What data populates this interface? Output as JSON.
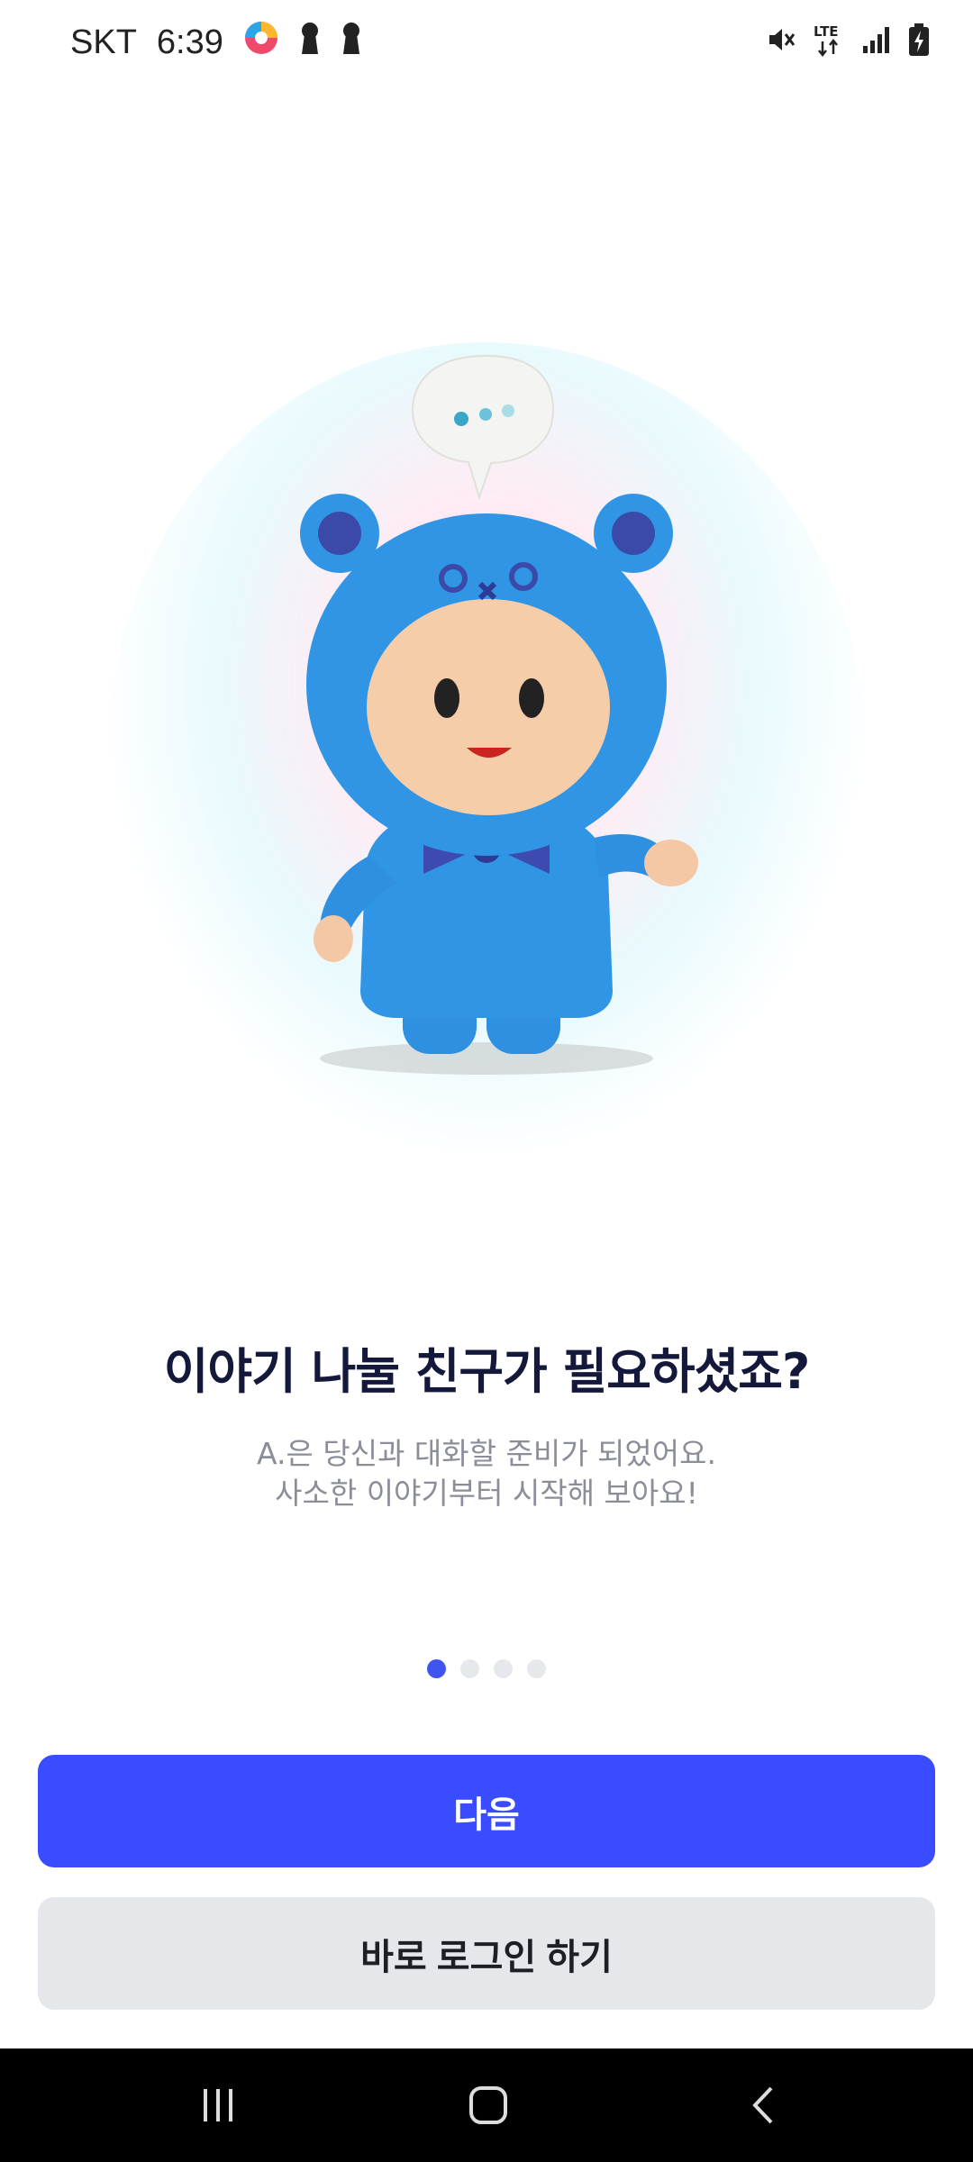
{
  "status_bar": {
    "carrier": "SKT",
    "time": "6:39",
    "icons": [
      "app-notification-icon",
      "keyhole-icon",
      "keyhole-icon",
      "mute-icon",
      "lte-icon",
      "signal-icon",
      "battery-charging-icon"
    ],
    "network": "LTE"
  },
  "onboarding": {
    "headline": "이야기 나눌 친구가 필요하셨죠?",
    "subtext_line1": "A.은 당신과 대화할 준비가 되었어요.",
    "subtext_line2": "사소한 이야기부터 시작해 보아요!",
    "page_index": 1,
    "page_count": 4
  },
  "buttons": {
    "next_label": "다음",
    "login_label": "바로 로그인 하기"
  },
  "colors": {
    "primary": "#3a4cff",
    "secondary_bg": "#e6e7eb",
    "headline": "#14183a",
    "subtext": "#8b8e99",
    "character_blue": "#2f95e4"
  },
  "nav_bar": {
    "icons": [
      "recent-apps-icon",
      "home-icon",
      "back-icon"
    ]
  }
}
